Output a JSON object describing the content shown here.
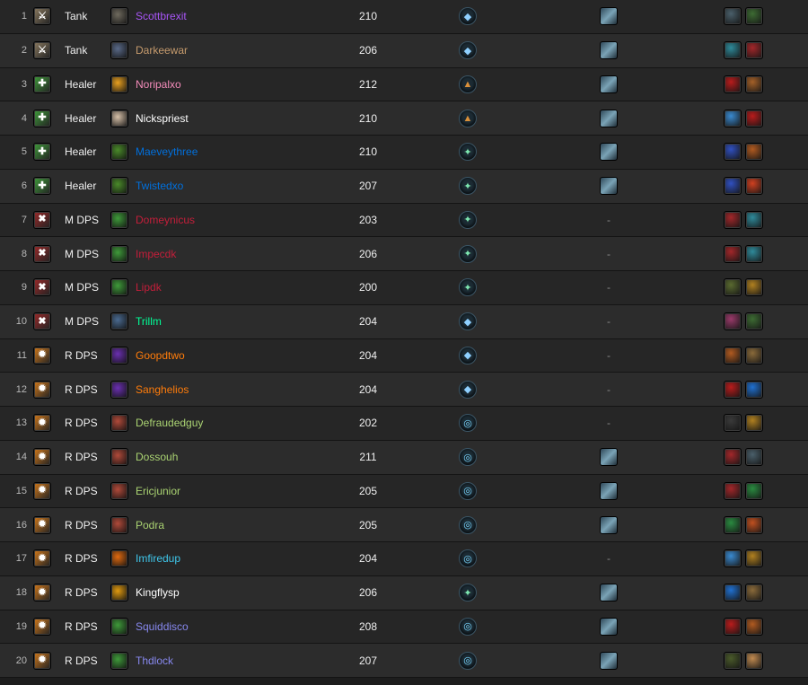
{
  "roles": {
    "Tank": {
      "icon": "sword-shield-icon",
      "color": "#8a7a60",
      "glyph": "⚔"
    },
    "Healer": {
      "icon": "healer-leaf-icon",
      "color": "#3f9a3a",
      "glyph": "✚"
    },
    "M DPS": {
      "icon": "melee-claw-icon",
      "color": "#9a2a2a",
      "glyph": "✖"
    },
    "R DPS": {
      "icon": "ranged-fire-icon",
      "color": "#d0781a",
      "glyph": "✹"
    }
  },
  "covenants": {
    "kyrian": {
      "icon": "kyrian-icon",
      "glyph": "◆",
      "color": "#8fd0ff"
    },
    "venthyr": {
      "icon": "venthyr-icon",
      "glyph": "▲",
      "color": "#d9903a"
    },
    "nightfae": {
      "icon": "night-fae-icon",
      "glyph": "✦",
      "color": "#7ee8b0"
    },
    "necrolord": {
      "icon": "necrolord-icon",
      "glyph": "◎",
      "color": "#79d7ff"
    }
  },
  "rows": [
    {
      "rank": "1",
      "role": "Tank",
      "class_icon": "warrior-icon",
      "class_color": "#6f6a5e",
      "name": "Scottbrexit",
      "name_color": "#a855f7",
      "ilvl": "210",
      "covenant": "kyrian",
      "legendary": true,
      "tk": [
        "#4a5f6a",
        "#3d6b33"
      ]
    },
    {
      "rank": "2",
      "role": "Tank",
      "class_icon": "paladin-icon",
      "class_color": "#5a6a88",
      "name": "Darkeewar",
      "name_color": "#c69b6d",
      "ilvl": "206",
      "covenant": "kyrian",
      "legendary": true,
      "tk": [
        "#2f8a9a",
        "#a2272a"
      ]
    },
    {
      "rank": "3",
      "role": "Healer",
      "class_icon": "holy-light-icon",
      "class_color": "#e8a020",
      "name": "Noripalxo",
      "name_color": "#f48cba",
      "ilvl": "212",
      "covenant": "venthyr",
      "legendary": true,
      "tk": [
        "#b81c1c",
        "#a46028"
      ]
    },
    {
      "rank": "4",
      "role": "Healer",
      "class_icon": "priest-icon",
      "class_color": "#d6c0a8",
      "name": "Nickspriest",
      "name_color": "#ffffff",
      "ilvl": "210",
      "covenant": "venthyr",
      "legendary": true,
      "tk": [
        "#3a8ad0",
        "#b81c1c"
      ]
    },
    {
      "rank": "5",
      "role": "Healer",
      "class_icon": "druid-icon",
      "class_color": "#4a8a2a",
      "name": "Maeveythree",
      "name_color": "#0070dd",
      "ilvl": "210",
      "covenant": "nightfae",
      "legendary": true,
      "tk": [
        "#3050c0",
        "#b05a20"
      ]
    },
    {
      "rank": "6",
      "role": "Healer",
      "class_icon": "druid-icon",
      "class_color": "#4a8a2a",
      "name": "Twistedxo",
      "name_color": "#0070dd",
      "ilvl": "207",
      "covenant": "nightfae",
      "legendary": true,
      "tk": [
        "#3050c0",
        "#d04020"
      ]
    },
    {
      "rank": "7",
      "role": "M DPS",
      "class_icon": "death-knight-icon",
      "class_color": "#3f9a3a",
      "name": "Domeynicus",
      "name_color": "#c41e3a",
      "ilvl": "203",
      "covenant": "nightfae",
      "legendary": false,
      "tk": [
        "#a2272a",
        "#2f8a9a"
      ]
    },
    {
      "rank": "8",
      "role": "M DPS",
      "class_icon": "death-knight-icon",
      "class_color": "#3f9a3a",
      "name": "Impecdk",
      "name_color": "#c41e3a",
      "ilvl": "206",
      "covenant": "nightfae",
      "legendary": false,
      "tk": [
        "#a2272a",
        "#2f8a9a"
      ]
    },
    {
      "rank": "9",
      "role": "M DPS",
      "class_icon": "death-knight-icon",
      "class_color": "#3f9a3a",
      "name": "Lipdk",
      "name_color": "#c41e3a",
      "ilvl": "200",
      "covenant": "nightfae",
      "legendary": false,
      "tk": [
        "#5a6a30",
        "#b08020"
      ]
    },
    {
      "rank": "10",
      "role": "M DPS",
      "class_icon": "monk-icon",
      "class_color": "#4a6a90",
      "name": "Trillm",
      "name_color": "#00ff98",
      "ilvl": "204",
      "covenant": "kyrian",
      "legendary": false,
      "tk": [
        "#9a3a6a",
        "#3d6b33"
      ]
    },
    {
      "rank": "11",
      "role": "R DPS",
      "class_icon": "shadow-icon",
      "class_color": "#6a30b0",
      "name": "Goopdtwo",
      "name_color": "#ff7c0a",
      "ilvl": "204",
      "covenant": "kyrian",
      "legendary": false,
      "tk": [
        "#b05a20",
        "#8a6a3a"
      ]
    },
    {
      "rank": "12",
      "role": "R DPS",
      "class_icon": "shadow-icon",
      "class_color": "#6a30b0",
      "name": "Sanghelios",
      "name_color": "#ff7c0a",
      "ilvl": "204",
      "covenant": "kyrian",
      "legendary": false,
      "tk": [
        "#b81c1c",
        "#2070d0"
      ]
    },
    {
      "rank": "13",
      "role": "R DPS",
      "class_icon": "hunter-icon",
      "class_color": "#b04a3a",
      "name": "Defraudedguy",
      "name_color": "#aad372",
      "ilvl": "202",
      "covenant": "necrolord",
      "legendary": false,
      "tk": [
        "#3a3a3a",
        "#b08020"
      ]
    },
    {
      "rank": "14",
      "role": "R DPS",
      "class_icon": "hunter-icon",
      "class_color": "#b04a3a",
      "name": "Dossouh",
      "name_color": "#aad372",
      "ilvl": "211",
      "covenant": "necrolord",
      "legendary": true,
      "tk": [
        "#a2272a",
        "#4a5f6a"
      ]
    },
    {
      "rank": "15",
      "role": "R DPS",
      "class_icon": "hunter-icon",
      "class_color": "#b04a3a",
      "name": "Ericjunior",
      "name_color": "#aad372",
      "ilvl": "205",
      "covenant": "necrolord",
      "legendary": true,
      "tk": [
        "#a2272a",
        "#2a8a40"
      ]
    },
    {
      "rank": "16",
      "role": "R DPS",
      "class_icon": "hunter-icon",
      "class_color": "#b04a3a",
      "name": "Podra",
      "name_color": "#aad372",
      "ilvl": "205",
      "covenant": "necrolord",
      "legendary": true,
      "tk": [
        "#2a8a40",
        "#c05020"
      ]
    },
    {
      "rank": "17",
      "role": "R DPS",
      "class_icon": "fire-icon",
      "class_color": "#e06a10",
      "name": "Imfiredup",
      "name_color": "#3fc7eb",
      "ilvl": "204",
      "covenant": "necrolord",
      "legendary": false,
      "tk": [
        "#3a8ad0",
        "#b08020"
      ]
    },
    {
      "rank": "18",
      "role": "R DPS",
      "class_icon": "warlock-icon",
      "class_color": "#e09a10",
      "name": "Kingflysp",
      "name_color": "#ffffff",
      "ilvl": "206",
      "covenant": "nightfae",
      "legendary": true,
      "tk": [
        "#2070d0",
        "#8a6a3a"
      ]
    },
    {
      "rank": "19",
      "role": "R DPS",
      "class_icon": "warlock-icon",
      "class_color": "#3f9a3a",
      "name": "Squiddisco",
      "name_color": "#8788ee",
      "ilvl": "208",
      "covenant": "necrolord",
      "legendary": true,
      "tk": [
        "#b81c1c",
        "#b05a20"
      ]
    },
    {
      "rank": "20",
      "role": "R DPS",
      "class_icon": "warlock-icon",
      "class_color": "#3f9a3a",
      "name": "Thdlock",
      "name_color": "#8788ee",
      "ilvl": "207",
      "covenant": "necrolord",
      "legendary": true,
      "tk": [
        "#4a5a2a",
        "#c08a50"
      ]
    }
  ],
  "empty_legendary": "-"
}
